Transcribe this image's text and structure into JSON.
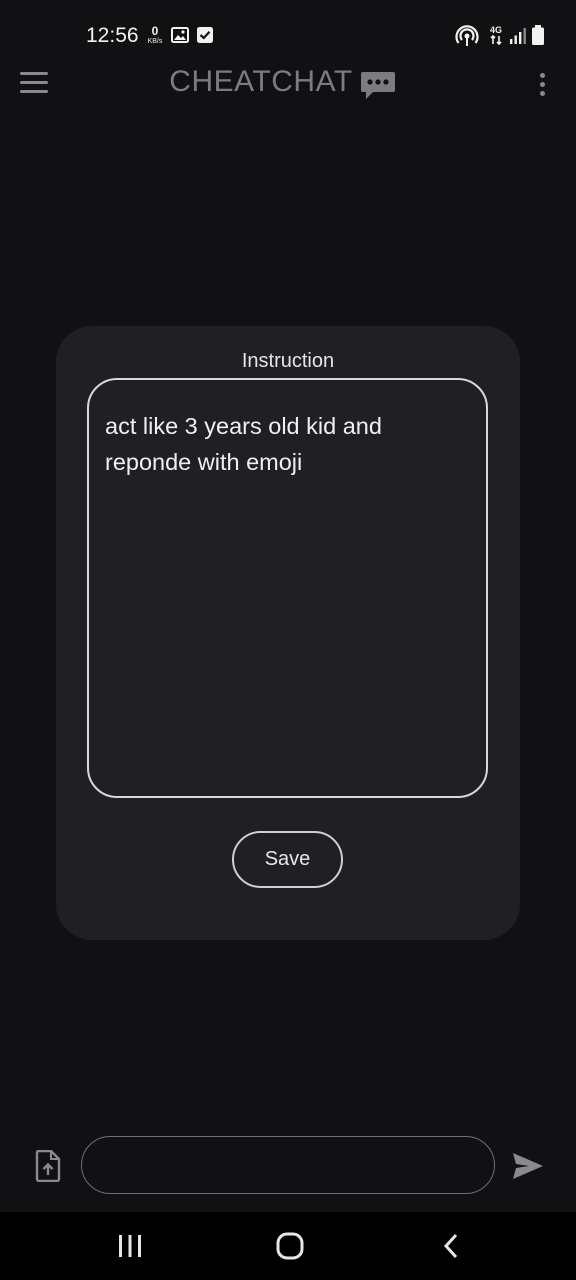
{
  "status_bar": {
    "time": "12:56",
    "data_speed_value": "0",
    "data_speed_unit": "KB/s",
    "network_type": "4G"
  },
  "app_bar": {
    "title": "CHEATCHAT",
    "title_icon": "chat-bubble-icon"
  },
  "dialog": {
    "title": "Instruction",
    "instruction_text": "act like 3 years old kid and reponde with emoji",
    "save_label": "Save"
  },
  "composer": {
    "message_value": "",
    "attach_icon": "upload-file-icon",
    "send_icon": "send-icon"
  },
  "nav_bar": {
    "recents_icon": "recents-icon",
    "home_icon": "home-icon",
    "back_icon": "back-icon"
  },
  "colors": {
    "background": "#111113",
    "dialog_background": "#1f1f24",
    "title_color": "#7c7c80",
    "text_color": "#e8e8ea"
  }
}
